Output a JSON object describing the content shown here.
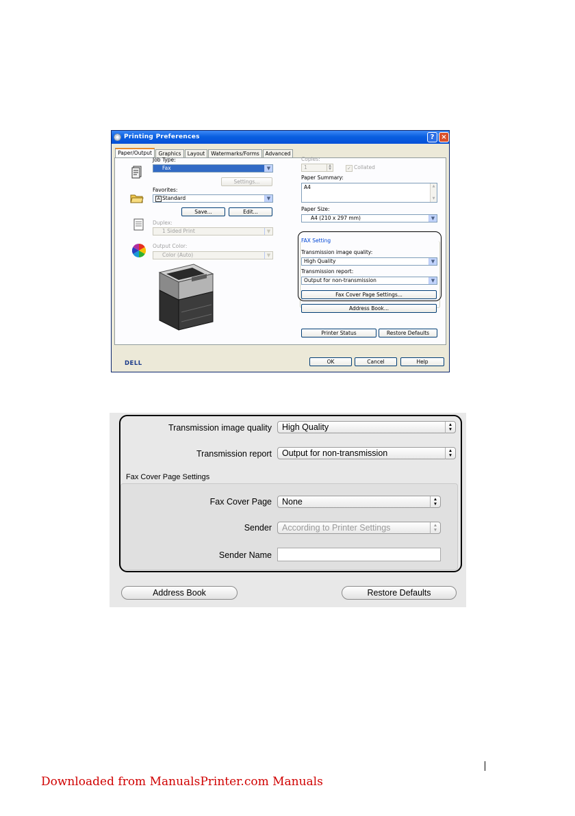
{
  "windows_dialog": {
    "title": "Printing Preferences",
    "help_button": "?",
    "close_button": "×",
    "tabs": [
      "Paper/Output",
      "Graphics",
      "Layout",
      "Watermarks/Forms",
      "Advanced"
    ],
    "job_type": {
      "label": "Job Type:",
      "value": "Fax",
      "settings_button": "Settings..."
    },
    "favorites": {
      "label": "Favorites:",
      "value": "Standard",
      "save_button": "Save...",
      "edit_button": "Edit..."
    },
    "duplex": {
      "label": "Duplex:",
      "value": "1 Sided Print"
    },
    "output_color": {
      "label": "Output Color:",
      "value": "Color (Auto)"
    },
    "copies": {
      "label": "Copies:",
      "value": "1",
      "collated_label": "Collated"
    },
    "paper_summary": {
      "label": "Paper Summary:",
      "value": "A4"
    },
    "paper_size": {
      "label": "Paper Size:",
      "value": "A4 (210 x 297 mm)"
    },
    "fax_setting": {
      "group_label": "FAX Setting",
      "quality_label": "Transmission image quality:",
      "quality_value": "High Quality",
      "report_label": "Transmission report:",
      "report_value": "Output for non-transmission",
      "cover_page_button": "Fax Cover Page Settings..."
    },
    "address_book_button": "Address Book...",
    "printer_status_button": "Printer Status",
    "restore_defaults_button": "Restore Defaults",
    "ok_button": "OK",
    "cancel_button": "Cancel",
    "help_bottom_button": "Help",
    "logo": "DELL"
  },
  "mac_panel": {
    "quality_label": "Transmission image quality",
    "quality_value": "High Quality",
    "report_label": "Transmission report",
    "report_value": "Output for non-transmission",
    "cover_group_label": "Fax Cover Page Settings",
    "cover_page_label": "Fax Cover Page",
    "cover_page_value": "None",
    "sender_label": "Sender",
    "sender_value": "According to Printer Settings",
    "sender_name_label": "Sender Name",
    "sender_name_value": "",
    "address_book_button": "Address Book",
    "restore_defaults_button": "Restore Defaults"
  },
  "footer": {
    "text": "Downloaded from ManualsPrinter.com Manuals"
  },
  "colors": {
    "title_bar": "#0a5fe0",
    "selected": "#316ac5",
    "footer_link": "#d00000"
  }
}
